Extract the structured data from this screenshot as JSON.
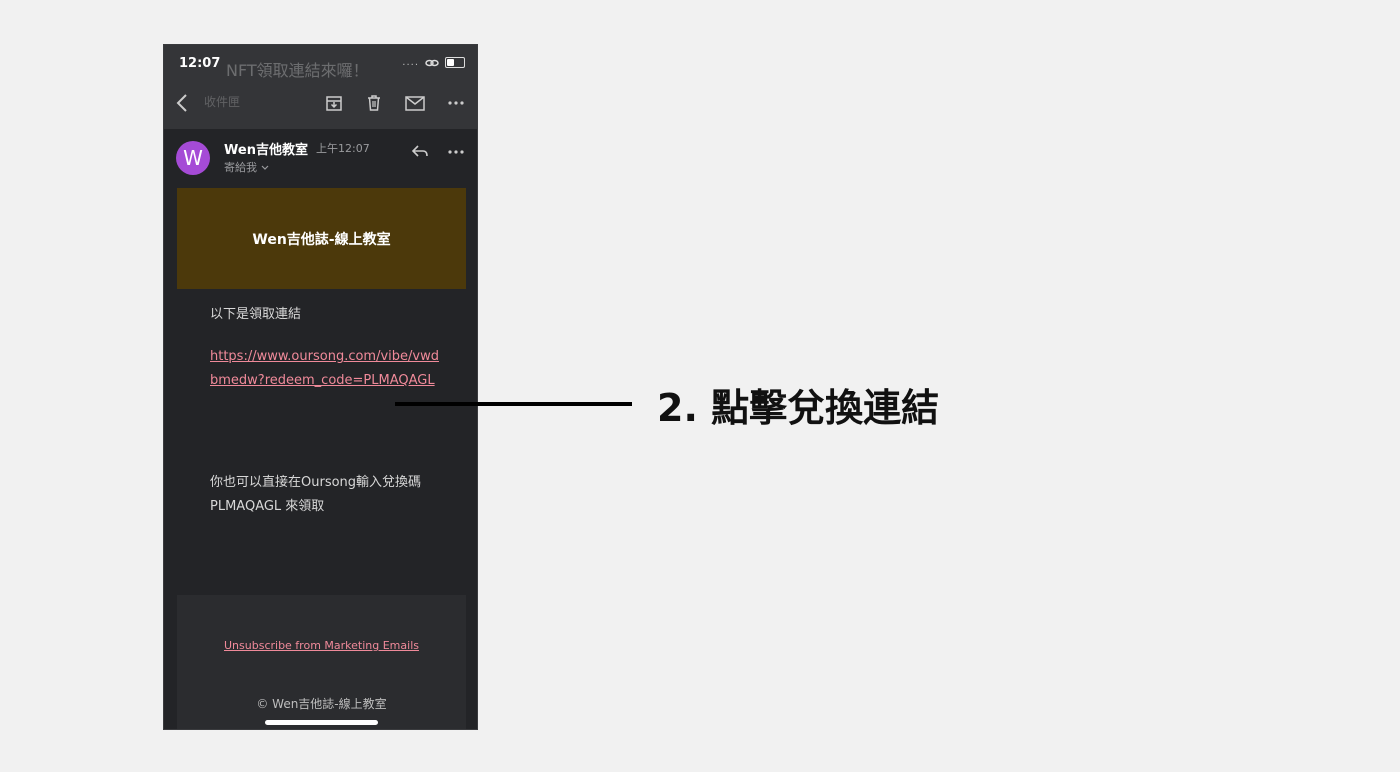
{
  "status_bar": {
    "time": "12:07",
    "signal": "...."
  },
  "email": {
    "subject_ghost": "NFT領取連結來囉！",
    "label_ghost": "收件匣",
    "sender": "Wen吉他教室",
    "time": "上午12:07",
    "to": "寄給我",
    "avatar_letter": "W",
    "banner_title": "Wen吉他誌-線上教室",
    "intro": "以下是領取連結",
    "link": "https://www.oursong.com/vibe/vwdbmedw?redeem_code=PLMAQAGL",
    "instruction": "你也可以直接在Oursong輸入兌換碼\nPLMAQAGL 來領取",
    "unsubscribe": "Unsubscribe from Marketing Emails",
    "footer": "© Wen吉他誌-線上教室"
  },
  "callout": {
    "text": "2. 點擊兌換連結"
  },
  "colors": {
    "background": "#f1f1f1",
    "phone_bg": "#232427",
    "banner": "#4c390b",
    "avatar": "#a54bd6",
    "link": "#f08a9a"
  }
}
